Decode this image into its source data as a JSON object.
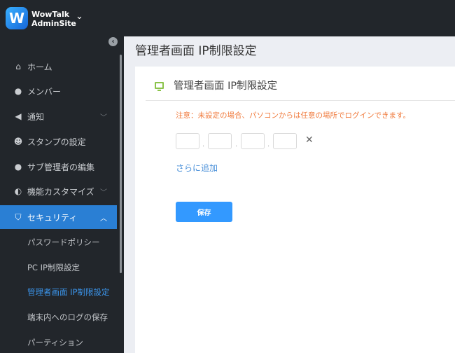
{
  "header": {
    "brand_line1": "WowTalk",
    "brand_line2": "AdminSite"
  },
  "sidebar": {
    "items": [
      {
        "label": "ホーム",
        "icon": "home-icon"
      },
      {
        "label": "メンバー",
        "icon": "user-icon"
      },
      {
        "label": "通知",
        "icon": "megaphone-icon"
      },
      {
        "label": "スタンプの設定",
        "icon": "smiley-icon"
      },
      {
        "label": "サブ管理者の編集",
        "icon": "user-icon"
      },
      {
        "label": "機能カスタマイズ",
        "icon": "toggle-icon"
      },
      {
        "label": "セキュリティ",
        "icon": "shield-icon"
      }
    ],
    "sub_items": [
      "パスワードポリシー",
      "PC IP制限設定",
      "管理者画面 IP制限設定",
      "端末内へのログの保存",
      "パーティション"
    ]
  },
  "main": {
    "page_title": "管理者画面 IP制限設定",
    "card_title": "管理者画面 IP制限設定",
    "note": "注意：未設定の場合、パソコンからは任意の場所でログインできます。",
    "ip_values": [
      "",
      "",
      "",
      ""
    ],
    "separator": ".",
    "add_more": "さらに追加",
    "save": "保存"
  },
  "colors": {
    "accent": "#2a7fd4",
    "warning": "#f07a3c",
    "button": "#3399ff"
  }
}
